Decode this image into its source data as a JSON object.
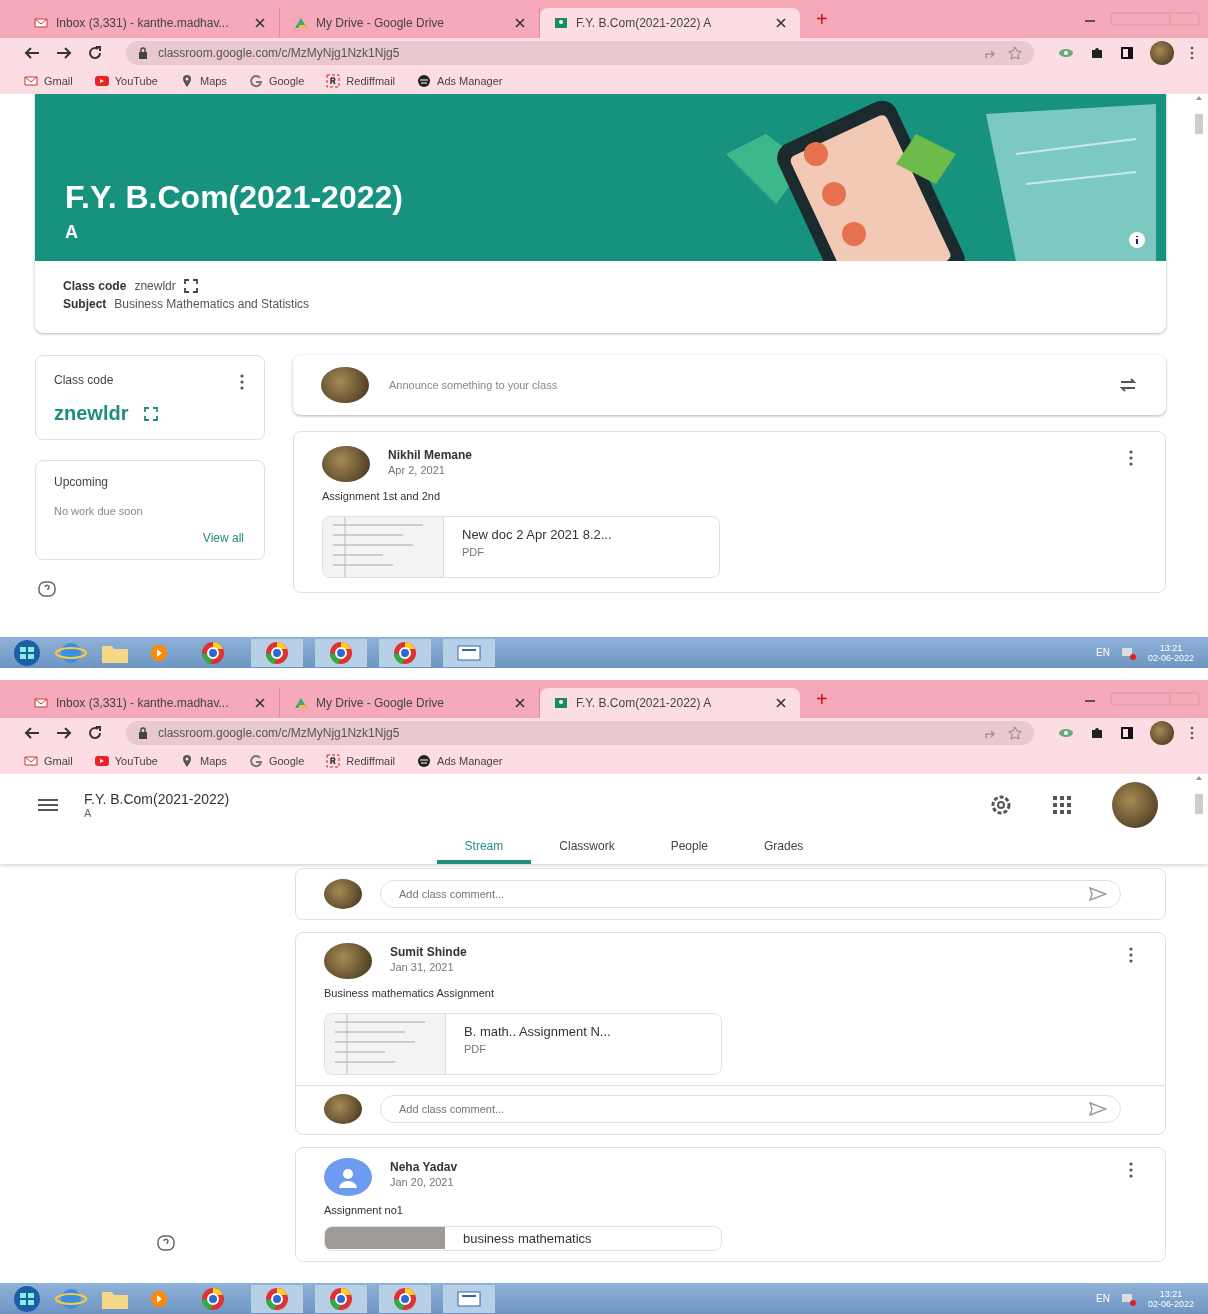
{
  "screens": [
    {
      "kind": "class-home",
      "browser": {
        "tabs": [
          {
            "title": "Inbox (3,331) - kanthe.madhav...",
            "selected": false
          },
          {
            "title": "My Drive - Google Drive",
            "selected": false
          },
          {
            "title": "F.Y. B.Com(2021-2022) A",
            "selected": true
          }
        ],
        "new_tab": "+",
        "url": "classroom.google.com/c/MzMyNjg1Nzk1Njg5",
        "bookmarks": [
          "Gmail",
          "YouTube",
          "Maps",
          "Google",
          "Rediffmail",
          "Ads Manager"
        ]
      },
      "banner": {
        "title": "F.Y. B.Com(2021-2022)",
        "section": "A"
      },
      "class_info": [
        {
          "label": "Class code",
          "value": "znewldr"
        },
        {
          "label": "Subject",
          "value": "Business Mathematics and Statistics"
        }
      ],
      "class_code_card": {
        "label": "Class code",
        "code": "znewldr"
      },
      "upcoming": {
        "title": "Upcoming",
        "message": "No work due soon",
        "link": "View all"
      },
      "announce": {
        "placeholder": "Announce something to your class"
      },
      "posts": [
        {
          "kind": "photo-avatar",
          "author": "Nikhil Memane",
          "date": "Apr 2, 2021",
          "text": "Assignment 1st and 2nd",
          "attachment": {
            "name": "New doc 2 Apr 2021 8.2...",
            "type": "PDF"
          }
        }
      ],
      "taskbar": {
        "language": "EN",
        "time": "13:21",
        "date": "02-06-2022"
      }
    },
    {
      "kind": "stream-scrolled",
      "browser": {
        "tabs": [
          {
            "title": "Inbox (3,331) - kanthe.madhav...",
            "selected": false
          },
          {
            "title": "My Drive - Google Drive",
            "selected": false
          },
          {
            "title": "F.Y. B.Com(2021-2022) A",
            "selected": true
          }
        ],
        "new_tab": "+",
        "url": "classroom.google.com/c/MzMyNjg1Nzk1Njg5",
        "bookmarks": [
          "Gmail",
          "YouTube",
          "Maps",
          "Google",
          "Rediffmail",
          "Ads Manager"
        ]
      },
      "header": {
        "title": "F.Y. B.Com(2021-2022)",
        "section": "A"
      },
      "nav_tabs": [
        {
          "label": "Stream",
          "selected": true
        },
        {
          "label": "Classwork",
          "selected": false
        },
        {
          "label": "People",
          "selected": false
        },
        {
          "label": "Grades",
          "selected": false
        }
      ],
      "top_comment": {
        "placeholder": "Add class comment..."
      },
      "posts": [
        {
          "kind": "photo-avatar",
          "author": "Sumit Shinde",
          "date": "Jan 31, 2021",
          "text": "Business mathematics Assignment",
          "attachment": {
            "name": "B. math.. Assignment N...",
            "type": "PDF"
          },
          "comment_placeholder": "Add class comment..."
        },
        {
          "kind": "generic-avatar",
          "author": "Neha Yadav",
          "date": "Jan 20, 2021",
          "text": "Assignment no1",
          "attachment": {
            "name": "business mathematics"
          }
        }
      ],
      "taskbar": {
        "language": "EN",
        "time": "13:21",
        "date": "02-06-2022"
      }
    }
  ]
}
